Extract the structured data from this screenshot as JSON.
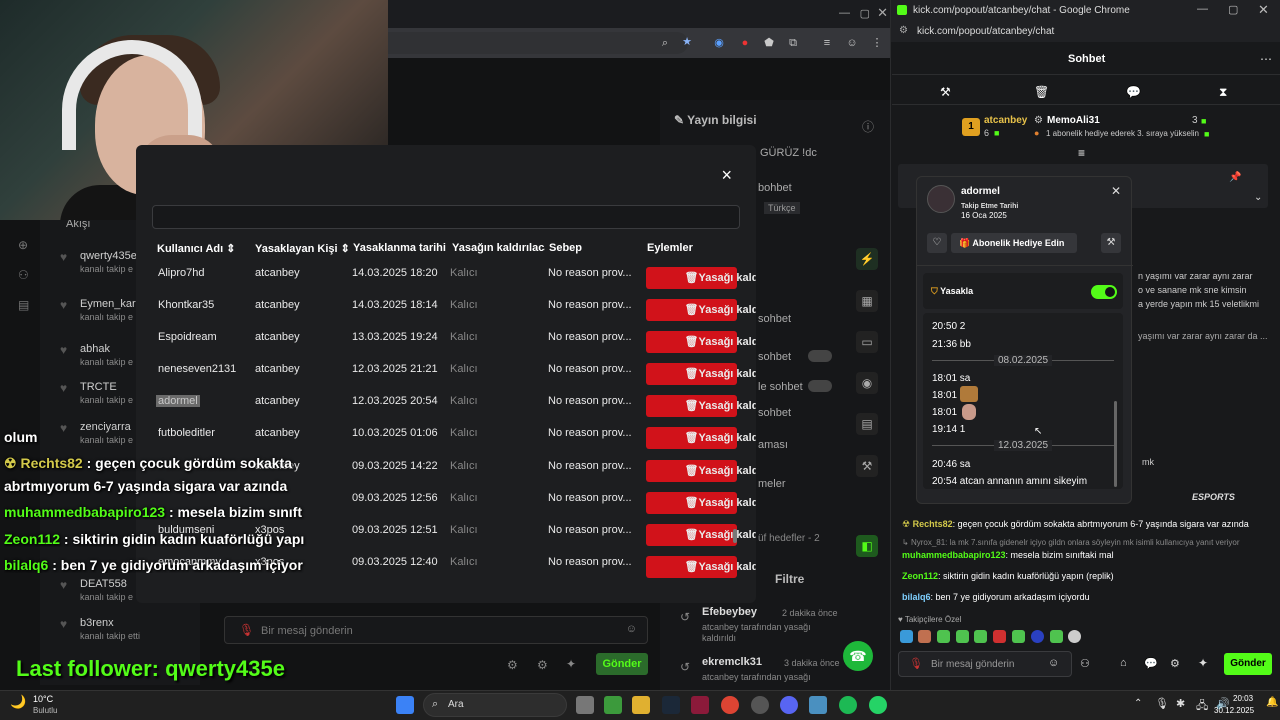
{
  "left_window": {
    "modal_close": "×",
    "columns": [
      "Kullanıcı Adı",
      "Yasaklayan Kişi",
      "Yasaklanma tarihi",
      "Yasağın kaldırılaca",
      "Sebep",
      "Eylemler"
    ],
    "rows": [
      {
        "user": "Alipro7hd",
        "by": "atcanbey",
        "date": "14.03.2025 18:20",
        "perm": "Kalıcı",
        "reason": "No reason prov...",
        "action": "Yasağı kaldır"
      },
      {
        "user": "Khontkar35",
        "by": "atcanbey",
        "date": "14.03.2025 18:14",
        "perm": "Kalıcı",
        "reason": "No reason prov...",
        "action": "Yasağı kaldır"
      },
      {
        "user": "Espoidream",
        "by": "atcanbey",
        "date": "13.03.2025 19:24",
        "perm": "Kalıcı",
        "reason": "No reason prov...",
        "action": "Yasağı kaldır"
      },
      {
        "user": "neneseven2131",
        "by": "atcanbey",
        "date": "12.03.2025 21:21",
        "perm": "Kalıcı",
        "reason": "No reason prov...",
        "action": "Yasağı kaldır"
      },
      {
        "user": "adormel",
        "by": "atcanbey",
        "date": "12.03.2025 20:54",
        "perm": "Kalıcı",
        "reason": "No reason prov...",
        "action": "Yasağı kaldır"
      },
      {
        "user": "futboleditler",
        "by": "atcanbey",
        "date": "10.03.2025 01:06",
        "perm": "Kalıcı",
        "reason": "No reason prov...",
        "action": "Yasağı kaldır"
      },
      {
        "user": "",
        "by": "atcanbey",
        "date": "09.03.2025 14:22",
        "perm": "Kalıcı",
        "reason": "No reason prov...",
        "action": "Yasağı kaldır"
      },
      {
        "user": "",
        "by": "",
        "date": "09.03.2025 12:56",
        "perm": "Kalıcı",
        "reason": "No reason prov...",
        "action": "Yasağı kaldır"
      },
      {
        "user": "buldumseni",
        "by": "x3pos",
        "date": "09.03.2025 12:51",
        "perm": "Kalıcı",
        "reason": "No reason prov...",
        "action": "Yasağı kaldır"
      },
      {
        "user": "emocanmmy",
        "by": "x3pos",
        "date": "09.03.2025 12:40",
        "perm": "Kalıcı",
        "reason": "No reason prov...",
        "action": "Yasağı kaldır"
      }
    ],
    "side_followers": [
      {
        "name": "qwerty435e",
        "sub": "kanalı takip e"
      },
      {
        "name": "Eymen_kar",
        "sub": "kanalı takip e"
      },
      {
        "name": "abhak",
        "sub": "kanalı takip e"
      },
      {
        "name": "TRCTE",
        "sub": "kanalı takip e"
      },
      {
        "name": "zenciyarra",
        "sub": "kanalı takip e"
      }
    ],
    "side_followers_bottom": [
      {
        "name": "DEAT558",
        "sub": "kanalı takip e"
      },
      {
        "name": "b3renx",
        "sub": "kanalı takip etti"
      }
    ],
    "akisi": "Akışı",
    "yayin_bilgisi": "Yayın bilgisi",
    "overlay_chat": [
      {
        "user": "",
        "text": "olum"
      },
      {
        "user": "Rechts82",
        "text": " : geçen çocuk gördüm sokakta"
      },
      {
        "user": "",
        "text": "abrtmıyorum 6-7 yaşında sigara var azında"
      },
      {
        "user": "muhammedbabapiro123",
        "text": " : mesela bizim sınıft"
      },
      {
        "user": "Zeon112",
        "text": " : siktirin gidin kadın kuaförlüğü yapı"
      },
      {
        "user": "bilalq6",
        "text": " : ben 7 ye gidiyorum arkadaşım içiyor"
      }
    ],
    "last_follower": "Last follower: qwerty435e",
    "send_placeholder": "Bir mesaj gönderin",
    "send_button": "Gönder",
    "filter": "Filtre",
    "right_activity": [
      {
        "name": "Efebeybey",
        "time": "2 dakika önce",
        "sub": "atcanbey tarafından yasağı kaldırıldı"
      },
      {
        "name": "ekremclk31",
        "time": "3 dakika önce",
        "sub": "atcanbey tarafından yasağı"
      }
    ],
    "misc_labels": [
      "GÜRÜZ !dc",
      "bohbet",
      "Türkçe",
      "sohbet",
      "sohbet",
      "le sohbet",
      "sohbet",
      "aması",
      "meler",
      "üf hedefler - 2"
    ]
  },
  "right_window": {
    "title": "kick.com/popout/atcanbey/chat - Google Chrome",
    "url": "kick.com/popout/atcanbey/chat",
    "chat_header": "Sohbet",
    "pinned": {
      "user1": "atcanbey",
      "count1": "6",
      "user2": "MemoAli31",
      "count2": "3",
      "text": "1 abonelik hediye ederek 3. sıraya yükselin"
    },
    "popup": {
      "name": "adormel",
      "follow_label": "Takip Etme Tarihi",
      "follow_date": "16 Oca 2025",
      "gift_button": "Abonelik Hediye Edin",
      "ban_label": "Yasakla",
      "messages": [
        {
          "t": "20:50 2"
        },
        {
          "t": "21:36 bb"
        },
        {
          "t": "18:01 sa"
        },
        {
          "t": "18:01"
        },
        {
          "t": "18:01"
        },
        {
          "t": "19:14 1"
        },
        {
          "t": "20:46 sa"
        },
        {
          "t": "20:54 atcan annanın amını sikeyim"
        }
      ],
      "date1": "08.02.2025",
      "date2": "12.03.2025"
    },
    "bg_chat_fragments": [
      "n yaşımı var zarar aynı zarar",
      "o ve sanane mk sne kimsin",
      "a yerde yapın mk 15 veletlikmi",
      "yaşımı var zarar aynı zarar da ...",
      "mk"
    ],
    "chat": [
      {
        "user": "Rechts82",
        "text": ": geçen çocuk gördüm sokakta abrtmıyorum 6-7 yaşında sigara var azında",
        "color": "#d3c94a"
      },
      {
        "user": "",
        "text": "Nyrox_81: la mk 7.sınıfa gidenelr içiyo gildn onlara söyleyin mk isimli kullanıcıya yanıt veriyor",
        "color": "#888888"
      },
      {
        "user": "muhammedbabapiro123",
        "text": ": mesela bizim sınıftaki mal",
        "color": "#53fc18"
      },
      {
        "user": "Zeon112",
        "text": ": siktirin gidin kadın kuaförlüğü yapın (replik)",
        "color": "#53fc18"
      },
      {
        "user": "bilalq6",
        "text": ": ben 7 ye gidiyorum arkadaşım içiyordu",
        "color": "#7fd0ff"
      }
    ],
    "emote_label": "Takipçilere Özel",
    "input_placeholder": "Bir mesaj gönderin",
    "send_button": "Gönder",
    "watermark": "ESPORTS"
  },
  "taskbar": {
    "weather_temp": "10°C",
    "weather_desc": "Bulutlu",
    "search": "Ara",
    "time": "20:03",
    "date": "30.12.2025"
  }
}
